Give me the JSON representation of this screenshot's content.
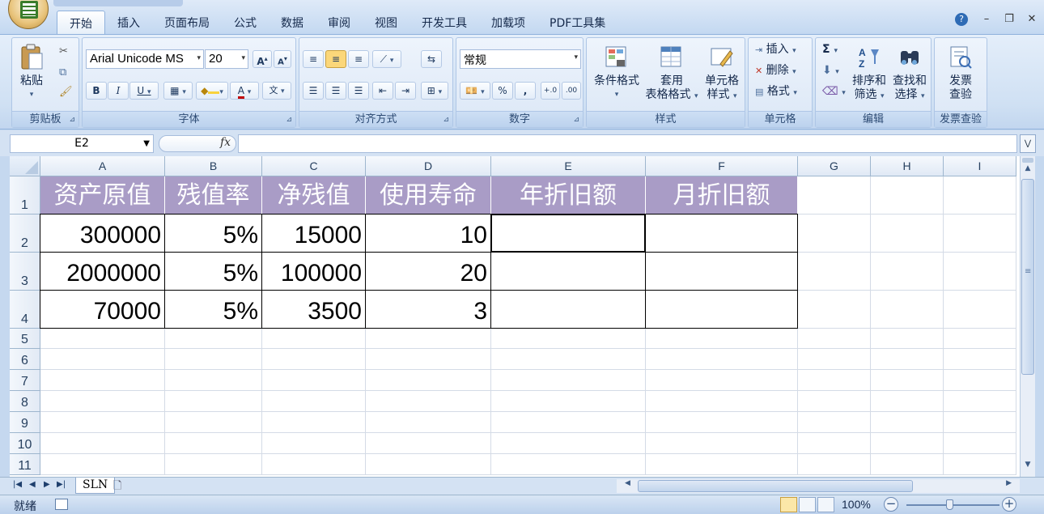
{
  "ribbon_tabs": [
    "开始",
    "插入",
    "页面布局",
    "公式",
    "数据",
    "审阅",
    "视图",
    "开发工具",
    "加载项",
    "PDF工具集"
  ],
  "active_tab": "开始",
  "groups": {
    "clipboard": {
      "label": "剪贴板",
      "paste": "粘贴"
    },
    "font": {
      "label": "字体",
      "font_name": "Arial Unicode MS",
      "font_size": "20"
    },
    "alignment": {
      "label": "对齐方式"
    },
    "number": {
      "label": "数字",
      "format": "常规",
      "percent": "%",
      "comma": ","
    },
    "styles": {
      "label": "样式",
      "conditional": "条件格式",
      "table_format_1": "套用",
      "table_format_2": "表格格式",
      "cell_style_1": "单元格",
      "cell_style_2": "样式"
    },
    "cells": {
      "label": "单元格",
      "insert": "插入",
      "delete": "删除",
      "format": "格式"
    },
    "editing": {
      "label": "编辑",
      "sort_1": "排序和",
      "sort_2": "筛选",
      "find_1": "查找和",
      "find_2": "选择"
    },
    "invoice": {
      "label": "发票查验",
      "btn_1": "发票",
      "btn_2": "查验"
    }
  },
  "formula_bar": {
    "name_box": "E2",
    "fx": "fx",
    "formula": ""
  },
  "columns": [
    "A",
    "B",
    "C",
    "D",
    "E",
    "F",
    "G",
    "H",
    "I"
  ],
  "rows": [
    "1",
    "2",
    "3",
    "4",
    "5",
    "6",
    "7",
    "8",
    "9",
    "10",
    "11"
  ],
  "table": {
    "headers": [
      "资产原值",
      "残值率",
      "净残值",
      "使用寿命",
      "年折旧额",
      "月折旧额"
    ],
    "data": [
      [
        "300000",
        "5%",
        "15000",
        "10",
        "",
        ""
      ],
      [
        "2000000",
        "5%",
        "100000",
        "20",
        "",
        ""
      ],
      [
        "70000",
        "5%",
        "3500",
        "3",
        "",
        ""
      ]
    ]
  },
  "sheet_tabs": [
    "SLN"
  ],
  "status": {
    "ready": "就绪",
    "zoom": "100%"
  },
  "colors": {
    "header_fill": "#a99cc6",
    "header_text": "#ffffff",
    "ribbon_bg": "#cfe0f3"
  }
}
